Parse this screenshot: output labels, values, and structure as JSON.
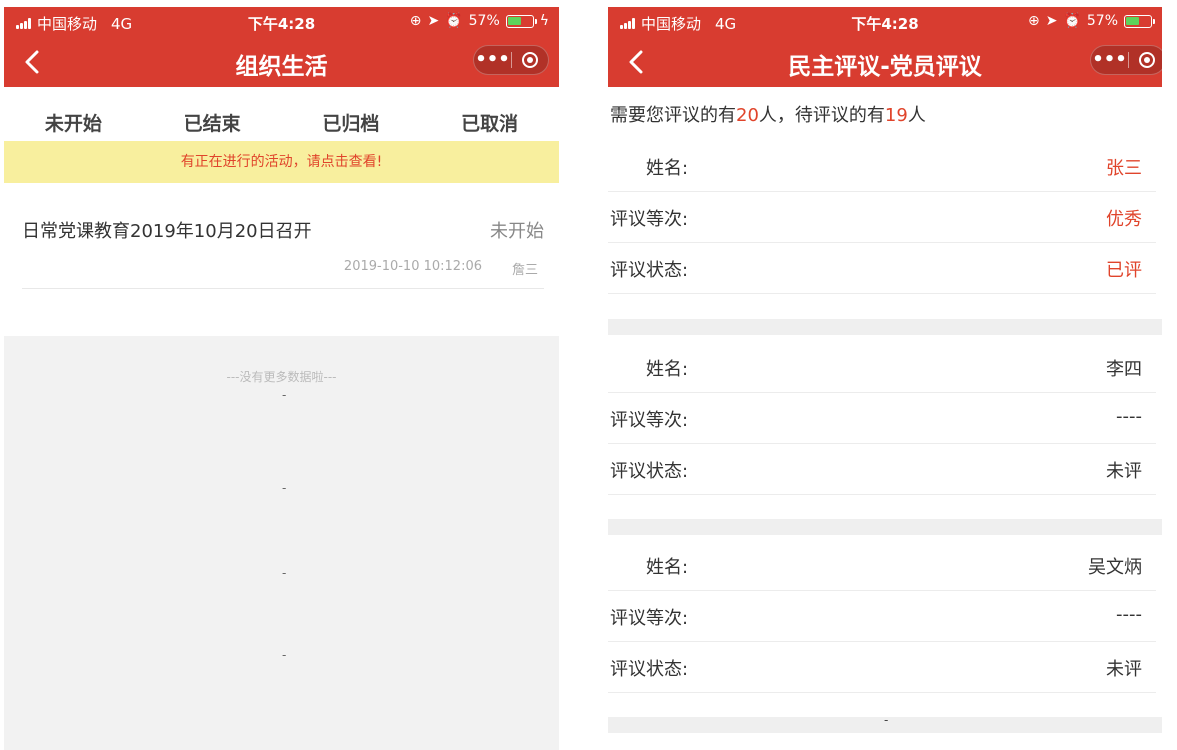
{
  "left": {
    "status_bar": {
      "carrier": "中国移动",
      "network": "4G",
      "time": "下午4:28",
      "battery": "57%",
      "battery_level": 0.57
    },
    "nav": {
      "title": "组织生活",
      "more": "•••"
    },
    "tabs": [
      "未开始",
      "已结束",
      "已归档",
      "已取消"
    ],
    "active_tab": 0,
    "notice": "有正在进行的活动，请点击查看!",
    "activity": {
      "title": "日常党课教育2019年10月20日召开",
      "status": "未开始",
      "time": "2019-10-10   10:12:06",
      "author": "詹三"
    },
    "empty_text": "---没有更多数据啦---",
    "dash": "-"
  },
  "right": {
    "status_bar": {
      "carrier": "中国移动",
      "network": "4G",
      "time": "下午4:28",
      "battery": "57%",
      "battery_level": 0.57
    },
    "nav": {
      "title": "民主评议-党员评议",
      "more": "•••"
    },
    "summary": {
      "prefix": "需要您评议的有",
      "total": "20",
      "middle": "人，待评议的有",
      "pending": "19",
      "suffix": "人"
    },
    "labels": {
      "name": "姓名:",
      "grade": "评议等次:",
      "state": "评议状态:"
    },
    "members": [
      {
        "name": "张三",
        "grade": "优秀",
        "state": "已评"
      },
      {
        "name": "李四",
        "grade": "----",
        "state": "未评"
      },
      {
        "name": "吴文炳",
        "grade": "----",
        "state": "未评"
      }
    ],
    "bottom_dash": "-"
  },
  "colors": {
    "brand": "#d83c30",
    "accent_text": "#e0442b",
    "notice_bg": "#f8ef9e"
  }
}
